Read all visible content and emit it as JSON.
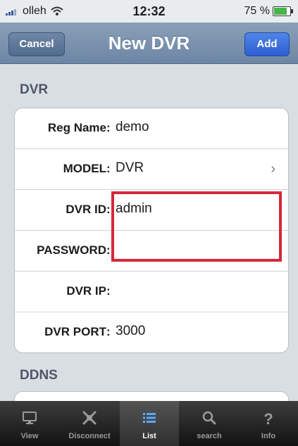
{
  "status": {
    "carrier": "olleh",
    "time": "12:32",
    "battery": "75 %"
  },
  "nav": {
    "cancel": "Cancel",
    "title": "New DVR",
    "add": "Add"
  },
  "sections": {
    "dvr": "DVR",
    "ddns": "DDNS"
  },
  "form": {
    "reg_name": {
      "label": "Reg Name",
      "value": "demo"
    },
    "model": {
      "label": "MODEL",
      "value": "DVR"
    },
    "dvr_id": {
      "label": "DVR ID",
      "value": "admin"
    },
    "password": {
      "label": "PASSWORD",
      "value": ""
    },
    "dvr_ip": {
      "label": "DVR IP",
      "value": ""
    },
    "dvr_port": {
      "label": "DVR PORT",
      "value": "3000"
    }
  },
  "tabs": [
    {
      "label": "View",
      "icon": "monitor-icon"
    },
    {
      "label": "Disconnect",
      "icon": "disconnect-icon"
    },
    {
      "label": "List",
      "icon": "list-icon"
    },
    {
      "label": "search",
      "icon": "search-icon"
    },
    {
      "label": "Info",
      "icon": "info-icon"
    }
  ],
  "colors": {
    "navbar": "#7a92ae",
    "add_button": "#3a6ee0",
    "highlight": "#d6283a"
  }
}
